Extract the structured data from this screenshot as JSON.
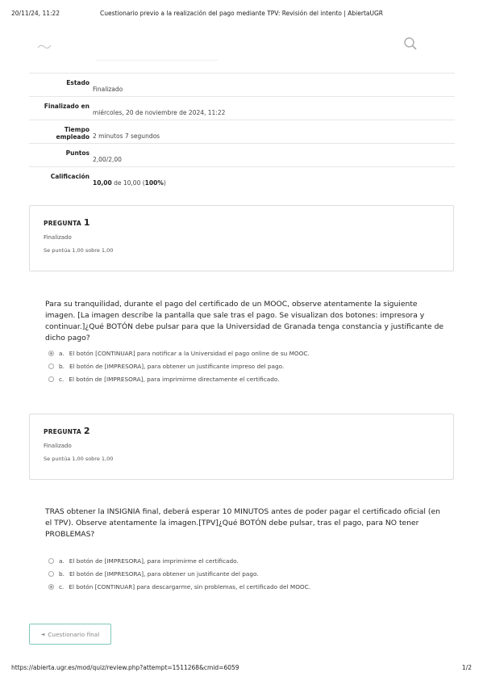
{
  "print_header": {
    "date": "20/11/24, 11:22",
    "title": "Cuestionario previo a la realización del pago mediante TPV: Revisión del intento | AbiertaUGR"
  },
  "print_footer": {
    "url": "https://abierta.ugr.es/mod/quiz/review.php?attempt=1511268&cmid=6059",
    "pager": "1/2"
  },
  "header": {
    "logo_icon": "site-logo",
    "search_icon": "search-icon"
  },
  "summary": [
    {
      "label": "Estado",
      "value": "Finalizado"
    },
    {
      "label": "Finalizado en",
      "value": "miércoles, 20 de noviembre de 2024, 11:22"
    },
    {
      "label": "Tiempo empleado",
      "value": "2 minutos 7 segundos"
    },
    {
      "label": "Puntos",
      "value": "2,00/2,00"
    }
  ],
  "grade": {
    "label": "Calificación",
    "score": "10,00",
    "middle": " de 10,00 (",
    "percent": "100%",
    "end": ")"
  },
  "questions": [
    {
      "title": "PREGUNTA",
      "number": "1",
      "state": "Finalizado",
      "grade": "Se puntúa 1,00 sobre 1,00",
      "text": "Para su tranquilidad, durante el pago del certificado de un MOOC, observe atentamente la siguiente imagen. [La imagen describe la pantalla que sale tras el pago. Se visualizan dos botones: impresora y continuar.]¿Qué BOTÓN debe pulsar para que la Universidad de Granada tenga constancia y justificante de dicho pago?",
      "answers": [
        {
          "letter": "a.",
          "text": "El botón [CONTINUAR] para notificar a la Universidad el pago online de su MOOC.",
          "checked": true
        },
        {
          "letter": "b.",
          "text": "El botón de [IMPRESORA], para obtener un justificante impreso del pago.",
          "checked": false
        },
        {
          "letter": "c.",
          "text": "El botón de [IMPRESORA], para imprimirme directamente el certificado.",
          "checked": false
        }
      ]
    },
    {
      "title": "PREGUNTA",
      "number": "2",
      "state": "Finalizado",
      "grade": "Se puntúa 1,00 sobre 1,00",
      "text": "TRAS obtener la INSIGNIA final, deberá esperar 10 MINUTOS antes de poder pagar el certificado oficial (en el TPV). Observe atentamente la imagen.[TPV]¿Qué BOTÓN debe pulsar, tras el pago, para NO tener PROBLEMAS?",
      "answers": [
        {
          "letter": "a.",
          "text": "El botón de [IMPRESORA], para imprimirme el certificado.",
          "checked": false
        },
        {
          "letter": "b.",
          "text": "El botón de [IMPRESORA], para obtener un justificante del pago.",
          "checked": false
        },
        {
          "letter": "c.",
          "text": "El botón [CONTINUAR] para descargarme, sin problemas, el certificado del MOOC.",
          "checked": true
        }
      ]
    }
  ],
  "nav": {
    "prev_label": "Cuestionario final",
    "arrow_icon": "triangle-left-icon"
  }
}
